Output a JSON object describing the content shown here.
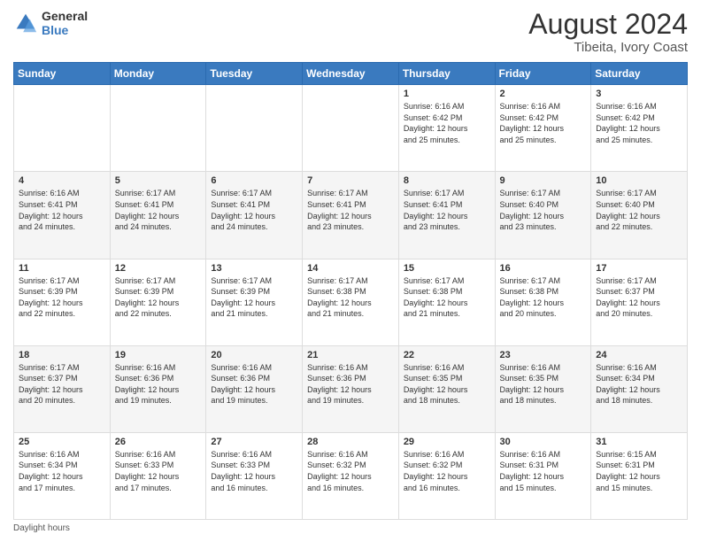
{
  "header": {
    "logo_line1": "General",
    "logo_line2": "Blue",
    "main_title": "August 2024",
    "sub_title": "Tibeita, Ivory Coast"
  },
  "calendar": {
    "days_of_week": [
      "Sunday",
      "Monday",
      "Tuesday",
      "Wednesday",
      "Thursday",
      "Friday",
      "Saturday"
    ],
    "weeks": [
      [
        {
          "day": "",
          "info": ""
        },
        {
          "day": "",
          "info": ""
        },
        {
          "day": "",
          "info": ""
        },
        {
          "day": "",
          "info": ""
        },
        {
          "day": "1",
          "info": "Sunrise: 6:16 AM\nSunset: 6:42 PM\nDaylight: 12 hours\nand 25 minutes."
        },
        {
          "day": "2",
          "info": "Sunrise: 6:16 AM\nSunset: 6:42 PM\nDaylight: 12 hours\nand 25 minutes."
        },
        {
          "day": "3",
          "info": "Sunrise: 6:16 AM\nSunset: 6:42 PM\nDaylight: 12 hours\nand 25 minutes."
        }
      ],
      [
        {
          "day": "4",
          "info": "Sunrise: 6:16 AM\nSunset: 6:41 PM\nDaylight: 12 hours\nand 24 minutes."
        },
        {
          "day": "5",
          "info": "Sunrise: 6:17 AM\nSunset: 6:41 PM\nDaylight: 12 hours\nand 24 minutes."
        },
        {
          "day": "6",
          "info": "Sunrise: 6:17 AM\nSunset: 6:41 PM\nDaylight: 12 hours\nand 24 minutes."
        },
        {
          "day": "7",
          "info": "Sunrise: 6:17 AM\nSunset: 6:41 PM\nDaylight: 12 hours\nand 23 minutes."
        },
        {
          "day": "8",
          "info": "Sunrise: 6:17 AM\nSunset: 6:41 PM\nDaylight: 12 hours\nand 23 minutes."
        },
        {
          "day": "9",
          "info": "Sunrise: 6:17 AM\nSunset: 6:40 PM\nDaylight: 12 hours\nand 23 minutes."
        },
        {
          "day": "10",
          "info": "Sunrise: 6:17 AM\nSunset: 6:40 PM\nDaylight: 12 hours\nand 22 minutes."
        }
      ],
      [
        {
          "day": "11",
          "info": "Sunrise: 6:17 AM\nSunset: 6:39 PM\nDaylight: 12 hours\nand 22 minutes."
        },
        {
          "day": "12",
          "info": "Sunrise: 6:17 AM\nSunset: 6:39 PM\nDaylight: 12 hours\nand 22 minutes."
        },
        {
          "day": "13",
          "info": "Sunrise: 6:17 AM\nSunset: 6:39 PM\nDaylight: 12 hours\nand 21 minutes."
        },
        {
          "day": "14",
          "info": "Sunrise: 6:17 AM\nSunset: 6:38 PM\nDaylight: 12 hours\nand 21 minutes."
        },
        {
          "day": "15",
          "info": "Sunrise: 6:17 AM\nSunset: 6:38 PM\nDaylight: 12 hours\nand 21 minutes."
        },
        {
          "day": "16",
          "info": "Sunrise: 6:17 AM\nSunset: 6:38 PM\nDaylight: 12 hours\nand 20 minutes."
        },
        {
          "day": "17",
          "info": "Sunrise: 6:17 AM\nSunset: 6:37 PM\nDaylight: 12 hours\nand 20 minutes."
        }
      ],
      [
        {
          "day": "18",
          "info": "Sunrise: 6:17 AM\nSunset: 6:37 PM\nDaylight: 12 hours\nand 20 minutes."
        },
        {
          "day": "19",
          "info": "Sunrise: 6:16 AM\nSunset: 6:36 PM\nDaylight: 12 hours\nand 19 minutes."
        },
        {
          "day": "20",
          "info": "Sunrise: 6:16 AM\nSunset: 6:36 PM\nDaylight: 12 hours\nand 19 minutes."
        },
        {
          "day": "21",
          "info": "Sunrise: 6:16 AM\nSunset: 6:36 PM\nDaylight: 12 hours\nand 19 minutes."
        },
        {
          "day": "22",
          "info": "Sunrise: 6:16 AM\nSunset: 6:35 PM\nDaylight: 12 hours\nand 18 minutes."
        },
        {
          "day": "23",
          "info": "Sunrise: 6:16 AM\nSunset: 6:35 PM\nDaylight: 12 hours\nand 18 minutes."
        },
        {
          "day": "24",
          "info": "Sunrise: 6:16 AM\nSunset: 6:34 PM\nDaylight: 12 hours\nand 18 minutes."
        }
      ],
      [
        {
          "day": "25",
          "info": "Sunrise: 6:16 AM\nSunset: 6:34 PM\nDaylight: 12 hours\nand 17 minutes."
        },
        {
          "day": "26",
          "info": "Sunrise: 6:16 AM\nSunset: 6:33 PM\nDaylight: 12 hours\nand 17 minutes."
        },
        {
          "day": "27",
          "info": "Sunrise: 6:16 AM\nSunset: 6:33 PM\nDaylight: 12 hours\nand 16 minutes."
        },
        {
          "day": "28",
          "info": "Sunrise: 6:16 AM\nSunset: 6:32 PM\nDaylight: 12 hours\nand 16 minutes."
        },
        {
          "day": "29",
          "info": "Sunrise: 6:16 AM\nSunset: 6:32 PM\nDaylight: 12 hours\nand 16 minutes."
        },
        {
          "day": "30",
          "info": "Sunrise: 6:16 AM\nSunset: 6:31 PM\nDaylight: 12 hours\nand 15 minutes."
        },
        {
          "day": "31",
          "info": "Sunrise: 6:15 AM\nSunset: 6:31 PM\nDaylight: 12 hours\nand 15 minutes."
        }
      ]
    ]
  },
  "footer": {
    "note": "Daylight hours"
  }
}
